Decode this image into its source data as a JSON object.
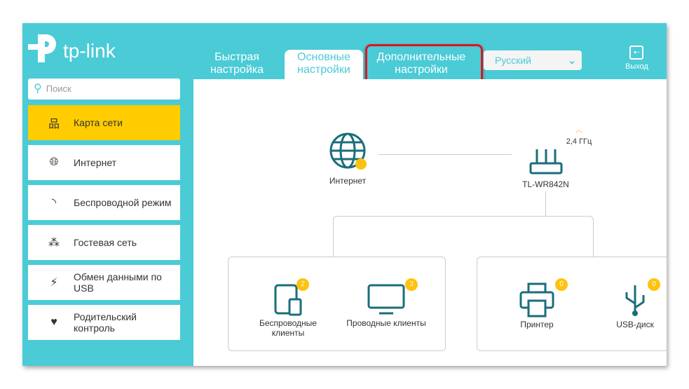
{
  "brand": "tp-link",
  "tabs": [
    {
      "label1": "Быстрая",
      "label2": "настройка"
    },
    {
      "label1": "Основные",
      "label2": "настройки"
    },
    {
      "label1": "Дополнительные",
      "label2": "настройки"
    }
  ],
  "language": "Русский",
  "exit_label": "Выход",
  "search_placeholder": "Поиск",
  "sidebar": [
    {
      "label": "Карта сети",
      "icon": "network-map-icon"
    },
    {
      "label": "Интернет",
      "icon": "globe-icon"
    },
    {
      "label": "Беспроводной режим",
      "icon": "wifi-icon"
    },
    {
      "label": "Гостевая сеть",
      "icon": "guest-icon"
    },
    {
      "label": "Обмен данными по USB",
      "icon": "usb-icon"
    },
    {
      "label": "Родительский контроль",
      "icon": "heart-icon"
    }
  ],
  "map": {
    "internet": "Интернет",
    "router": "TL-WR842N",
    "band": "2,4 ГГц",
    "wireless_clients": {
      "label": "Беспроводные клиенты",
      "count": "2"
    },
    "wired_clients": {
      "label": "Проводные клиенты",
      "count": "3"
    },
    "printer": {
      "label": "Принтер",
      "count": "0"
    },
    "usb": {
      "label": "USB-диск",
      "count": "0"
    }
  }
}
